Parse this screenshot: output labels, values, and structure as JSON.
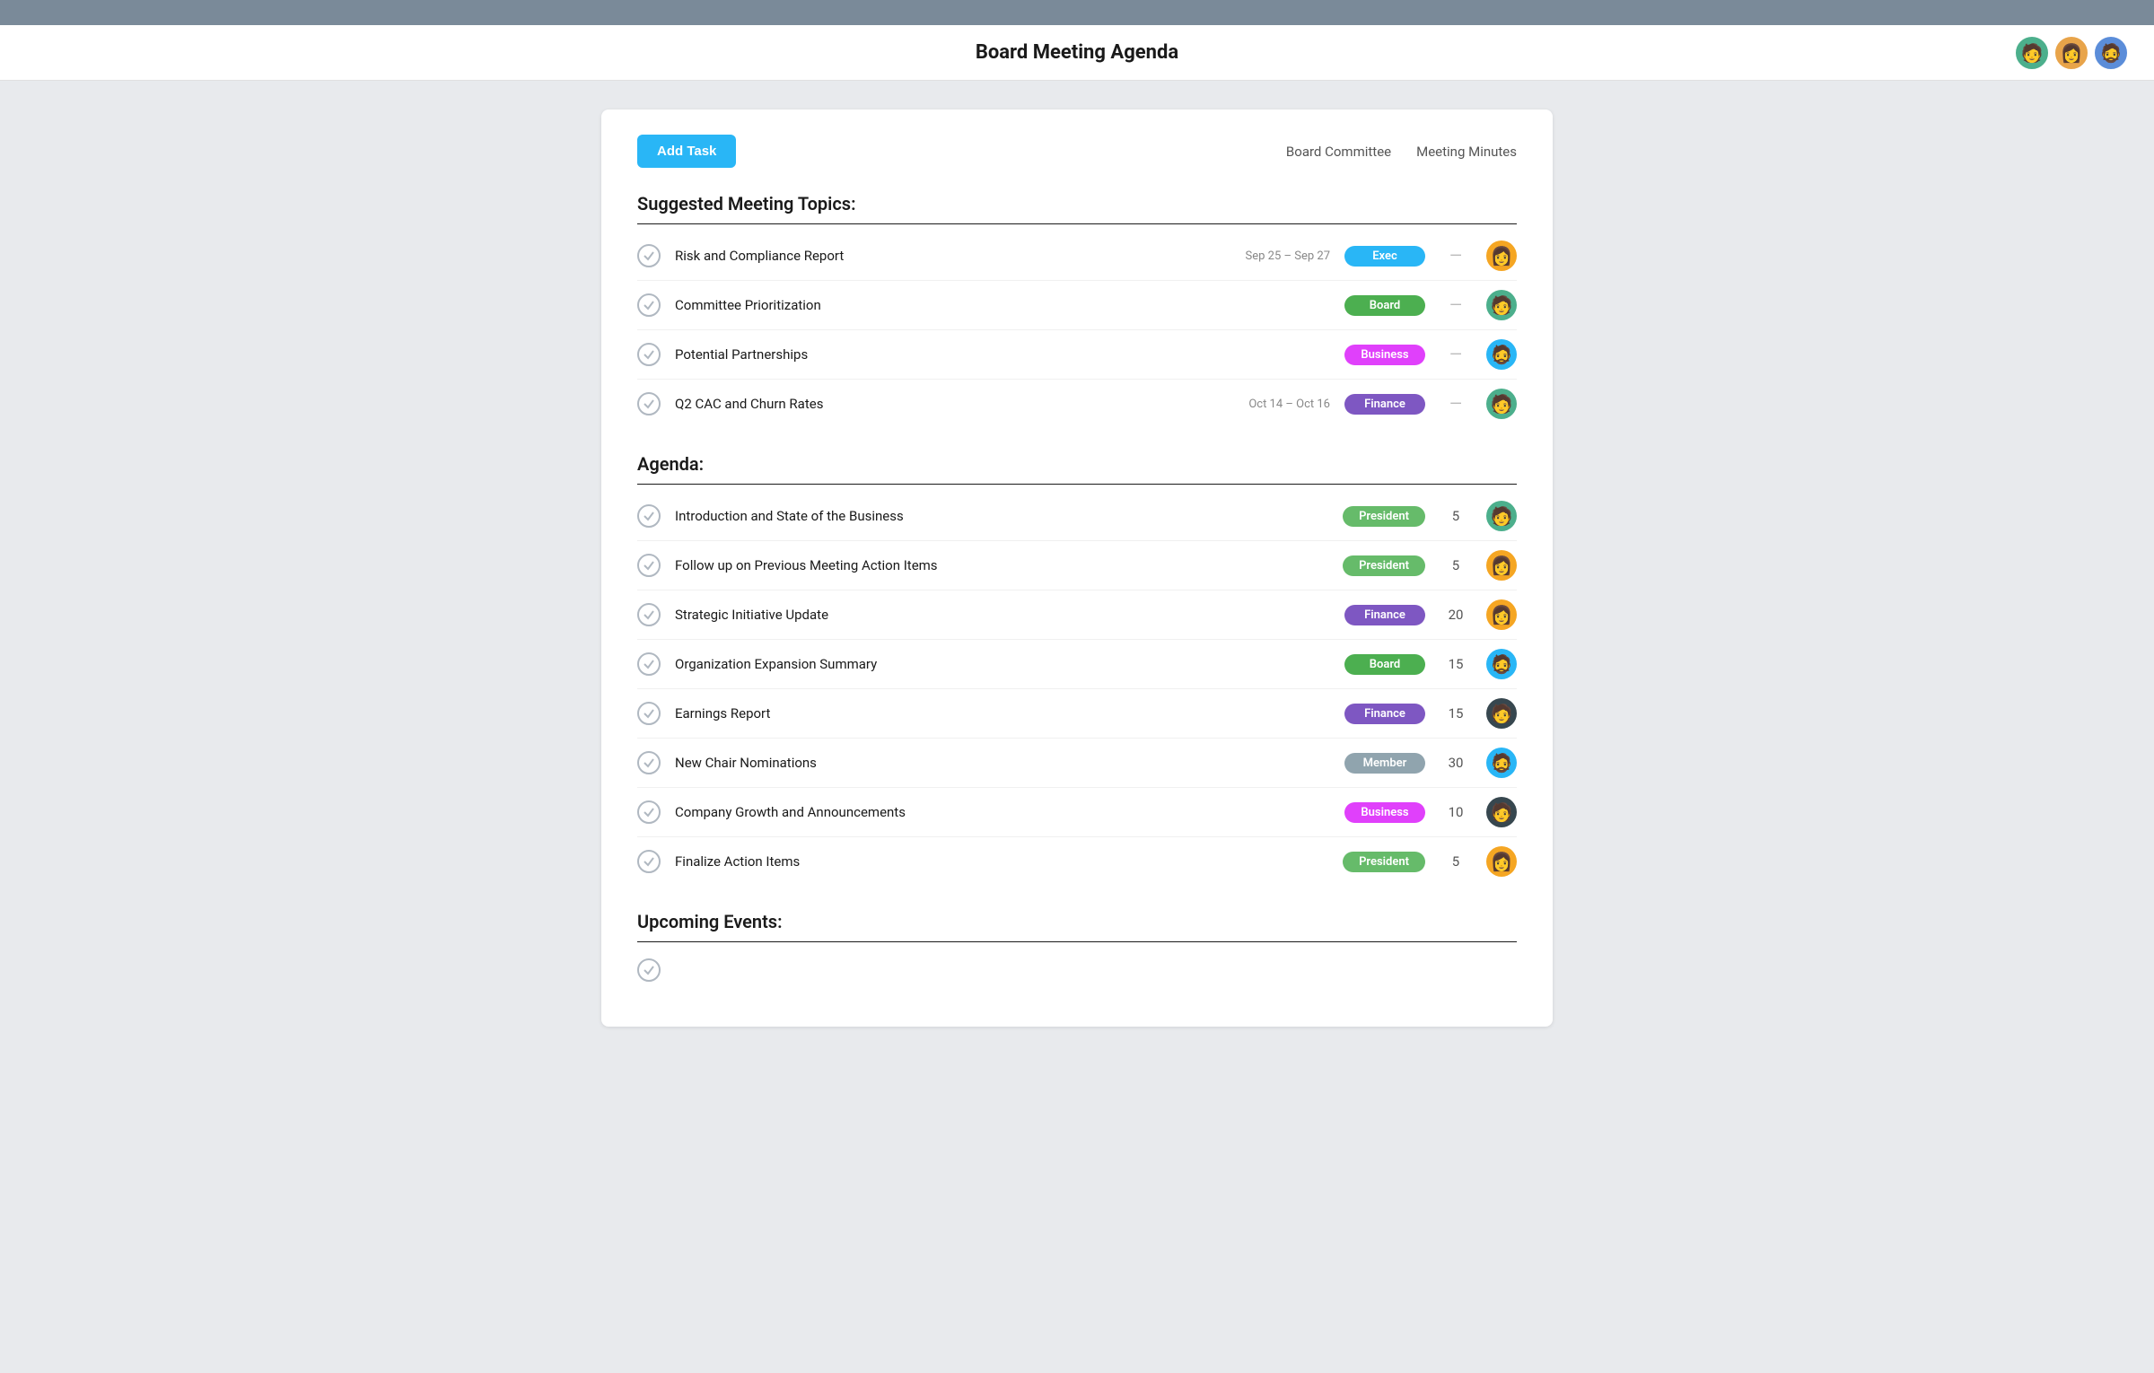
{
  "topbar": {},
  "header": {
    "title": "Board Meeting Agenda",
    "avatars": [
      {
        "id": "a1",
        "emoji": "🧑",
        "colorClass": "a1"
      },
      {
        "id": "a2",
        "emoji": "👩",
        "colorClass": "a2"
      },
      {
        "id": "a3",
        "emoji": "🧔",
        "colorClass": "a3"
      }
    ]
  },
  "toolbar": {
    "add_task_label": "Add Task",
    "links": [
      "Board Committee",
      "Meeting Minutes"
    ]
  },
  "suggested_section": {
    "title": "Suggested Meeting Topics:",
    "tasks": [
      {
        "name": "Risk and Compliance Report",
        "date": "Sep 25 – Sep 27",
        "tag": "Exec",
        "tagClass": "tag-exec",
        "duration": "—",
        "avatarClass": "av-yellow",
        "emoji": "👩"
      },
      {
        "name": "Committee Prioritization",
        "date": "",
        "tag": "Board",
        "tagClass": "tag-board",
        "duration": "—",
        "avatarClass": "av-green",
        "emoji": "🧑"
      },
      {
        "name": "Potential Partnerships",
        "date": "",
        "tag": "Business",
        "tagClass": "tag-business",
        "duration": "—",
        "avatarClass": "av-blue",
        "emoji": "🧔"
      },
      {
        "name": "Q2 CAC and Churn Rates",
        "date": "Oct 14 – Oct 16",
        "tag": "Finance",
        "tagClass": "tag-finance",
        "duration": "—",
        "avatarClass": "av-green",
        "emoji": "🧑"
      }
    ]
  },
  "agenda_section": {
    "title": "Agenda:",
    "tasks": [
      {
        "name": "Introduction and State of the Business",
        "date": "",
        "tag": "President",
        "tagClass": "tag-president",
        "duration": "5",
        "avatarClass": "av-green",
        "emoji": "🧑"
      },
      {
        "name": "Follow up on Previous Meeting Action Items",
        "date": "",
        "tag": "President",
        "tagClass": "tag-president",
        "duration": "5",
        "avatarClass": "av-yellow",
        "emoji": "👩"
      },
      {
        "name": "Strategic Initiative Update",
        "date": "",
        "tag": "Finance",
        "tagClass": "tag-finance",
        "duration": "20",
        "avatarClass": "av-yellow",
        "emoji": "👩"
      },
      {
        "name": "Organization Expansion Summary",
        "date": "",
        "tag": "Board",
        "tagClass": "tag-board",
        "duration": "15",
        "avatarClass": "av-blue",
        "emoji": "🧔"
      },
      {
        "name": "Earnings Report",
        "date": "",
        "tag": "Finance",
        "tagClass": "tag-finance",
        "duration": "15",
        "avatarClass": "av-dark",
        "emoji": "🧑"
      },
      {
        "name": "New Chair Nominations",
        "date": "",
        "tag": "Member",
        "tagClass": "tag-member",
        "duration": "30",
        "avatarClass": "av-blue",
        "emoji": "🧔"
      },
      {
        "name": "Company Growth and Announcements",
        "date": "",
        "tag": "Business",
        "tagClass": "tag-business",
        "duration": "10",
        "avatarClass": "av-dark",
        "emoji": "🧑"
      },
      {
        "name": "Finalize Action Items",
        "date": "",
        "tag": "President",
        "tagClass": "tag-president",
        "duration": "5",
        "avatarClass": "av-yellow",
        "emoji": "👩"
      }
    ]
  },
  "upcoming_section": {
    "title": "Upcoming Events:"
  }
}
